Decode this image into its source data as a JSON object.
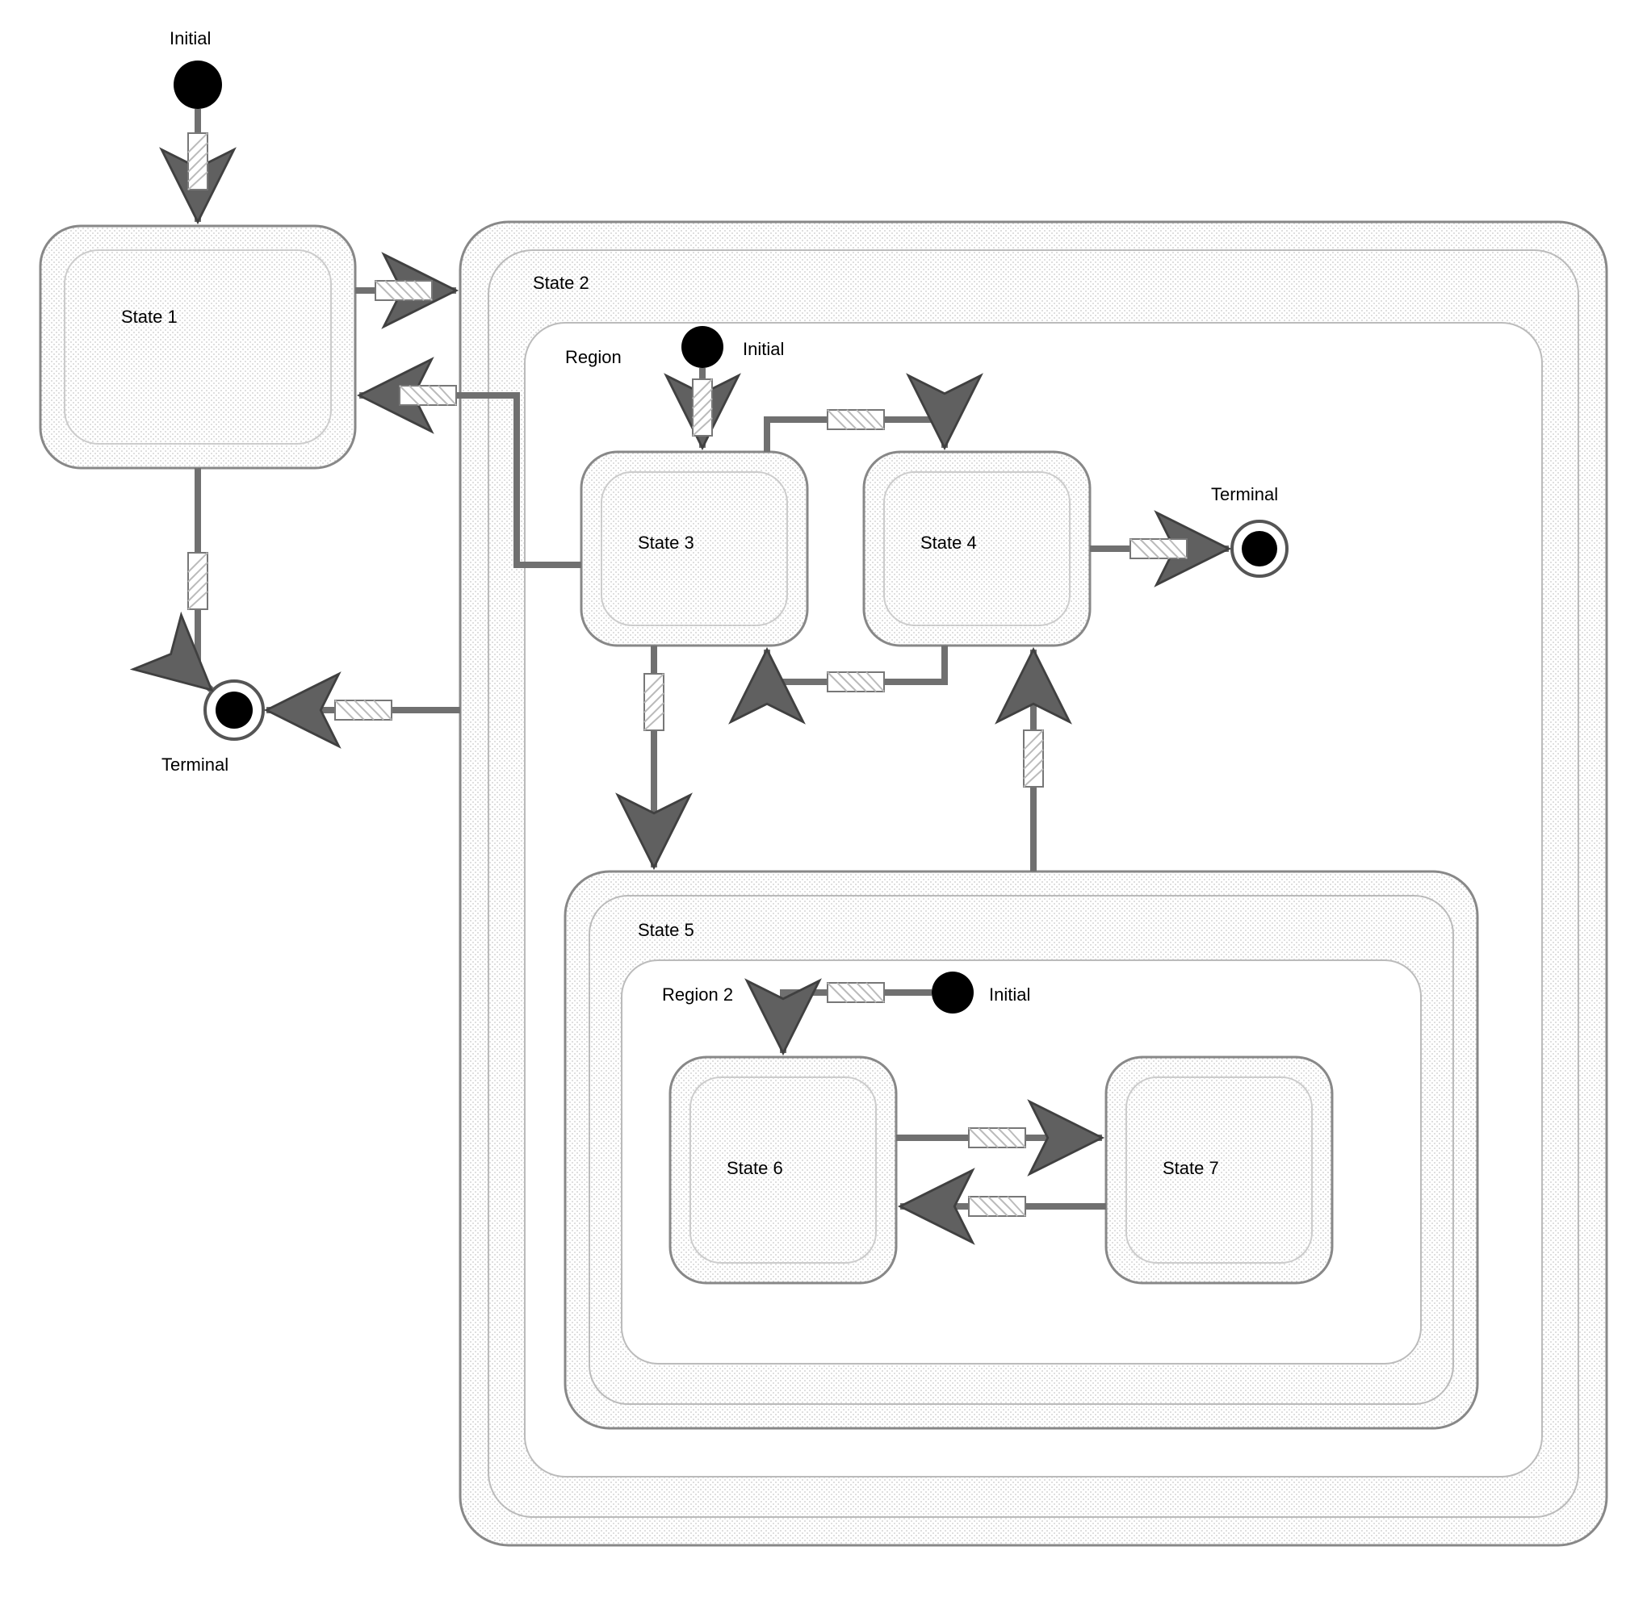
{
  "diagram": {
    "type": "uml-state-machine",
    "initials": {
      "top": "Initial",
      "region": "Initial",
      "region2": "Initial"
    },
    "terminals": {
      "left": "Terminal",
      "right": "Terminal"
    },
    "states": {
      "s1": "State 1",
      "s2": "State 2",
      "s3": "State 3",
      "s4": "State 4",
      "s5": "State 5",
      "s6": "State 6",
      "s7": "State 7"
    },
    "regions": {
      "r1": "Region",
      "r2": "Region 2"
    },
    "transitions": [
      {
        "from": "Initial(top)",
        "to": "State 1"
      },
      {
        "from": "State 1",
        "to": "State 2"
      },
      {
        "from": "State 2.Region.State 3",
        "to": "State 1"
      },
      {
        "from": "State 1",
        "to": "Terminal(left)"
      },
      {
        "from": "State 2",
        "to": "Terminal(left)"
      },
      {
        "from": "Initial(Region)",
        "to": "State 3"
      },
      {
        "from": "State 3",
        "to": "State 4"
      },
      {
        "from": "State 4",
        "to": "State 3"
      },
      {
        "from": "State 4",
        "to": "Terminal(right)"
      },
      {
        "from": "State 3",
        "to": "State 5"
      },
      {
        "from": "State 5",
        "to": "State 4"
      },
      {
        "from": "Initial(Region 2)",
        "to": "State 6"
      },
      {
        "from": "State 6",
        "to": "State 7"
      },
      {
        "from": "State 7",
        "to": "State 6"
      }
    ]
  }
}
